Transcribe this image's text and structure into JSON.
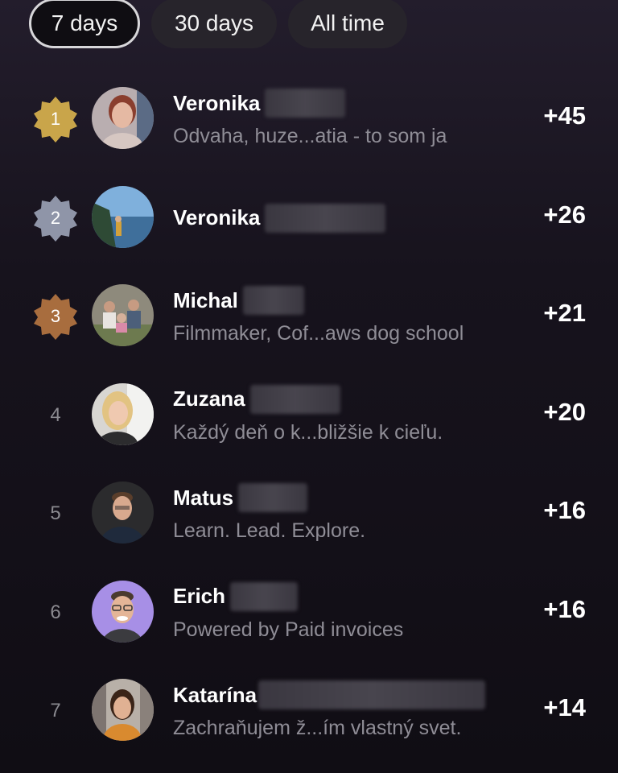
{
  "tabs": [
    {
      "label": "7 days",
      "selected": true
    },
    {
      "label": "30 days",
      "selected": false
    },
    {
      "label": "All time",
      "selected": false
    }
  ],
  "badge_colors": {
    "gold": "#c9a54a",
    "silver": "#8f95a8",
    "bronze": "#a86d3e"
  },
  "leaderboard": [
    {
      "rank": "1",
      "badge": "gold",
      "name": "Veronika",
      "subtitle": "Odvaha, huze...atia - to som ja",
      "points": "+45"
    },
    {
      "rank": "2",
      "badge": "silver",
      "name": "Veronika",
      "subtitle": "",
      "points": "+26"
    },
    {
      "rank": "3",
      "badge": "bronze",
      "name": "Michal",
      "subtitle": "Filmmaker, Cof...aws dog school",
      "points": "+21"
    },
    {
      "rank": "4",
      "badge": "none",
      "name": "Zuzana",
      "subtitle": "Každý deň o k...bližšie k cieľu.",
      "points": "+20"
    },
    {
      "rank": "5",
      "badge": "none",
      "name": "Matus",
      "subtitle": "Learn. Lead. Explore.",
      "points": "+16"
    },
    {
      "rank": "6",
      "badge": "none",
      "name": "Erich",
      "subtitle": "Powered by Paid invoices",
      "points": "+16"
    },
    {
      "rank": "7",
      "badge": "none",
      "name": "Katarína",
      "subtitle": "Zachraňujem ž...ím vlastný svet.",
      "points": "+14"
    }
  ]
}
